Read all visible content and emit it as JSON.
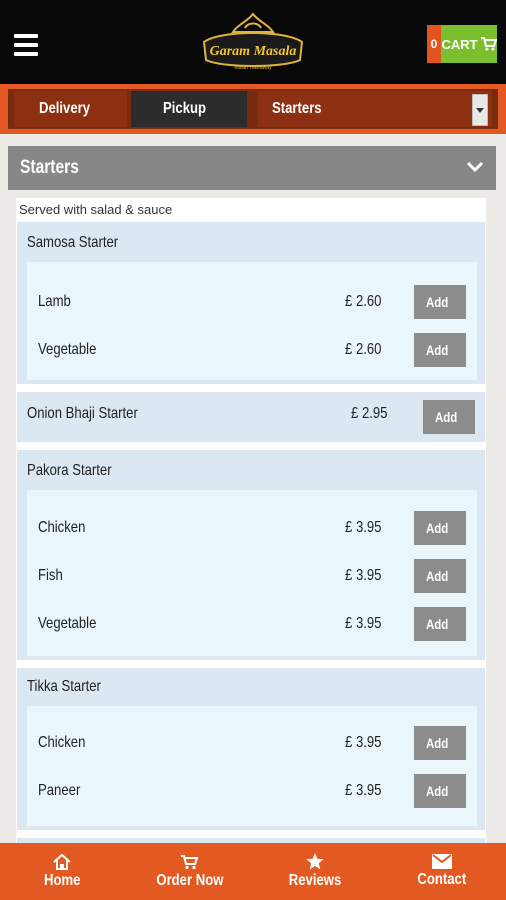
{
  "header": {
    "logo_text": "Garam Masala",
    "logo_subtext": "Indian Takeaway",
    "cart_count": "0",
    "cart_label": "CART"
  },
  "toolbar": {
    "delivery_label": "Delivery",
    "pickup_label": "Pickup",
    "category_selected": "Starters"
  },
  "section": {
    "title": "Starters",
    "note": "Served with salad & sauce"
  },
  "menu": {
    "add_label": "Add",
    "groups": [
      {
        "title": "Samosa Starter",
        "items": [
          {
            "name": "Lamb",
            "price": "£ 2.60"
          },
          {
            "name": "Vegetable",
            "price": "£ 2.60"
          }
        ]
      },
      {
        "title": "Onion Bhaji Starter",
        "price": "£ 2.95"
      },
      {
        "title": "Pakora Starter",
        "items": [
          {
            "name": "Chicken",
            "price": "£ 3.95"
          },
          {
            "name": "Fish",
            "price": "£ 3.95"
          },
          {
            "name": "Vegetable",
            "price": "£ 3.95"
          }
        ]
      },
      {
        "title": "Tikka Starter",
        "items": [
          {
            "name": "Chicken",
            "price": "£ 3.95"
          },
          {
            "name": "Paneer",
            "price": "£ 3.95"
          }
        ]
      }
    ]
  },
  "bottom_nav": {
    "home": "Home",
    "order_now": "Order Now",
    "reviews": "Reviews",
    "contact": "Contact"
  },
  "colors": {
    "header_bg": "#080808",
    "accent_orange": "#e25a21",
    "cart_green": "#7bbf2c",
    "section_gray": "#878787",
    "add_button_gray": "#8c8c8c"
  }
}
